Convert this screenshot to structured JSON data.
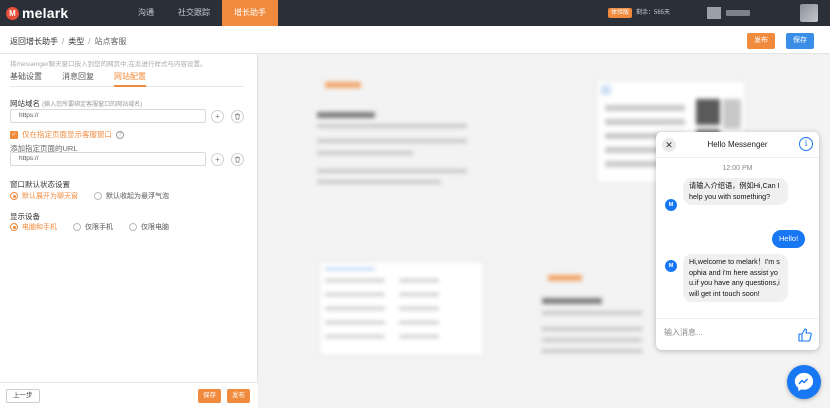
{
  "brand": {
    "name": "melark",
    "mark": "M"
  },
  "nav": [
    {
      "label": "沟通",
      "active": false
    },
    {
      "label": "社交跟踪",
      "active": false
    },
    {
      "label": "增长助手",
      "active": true
    }
  ],
  "account": {
    "trial_badge": "体验版",
    "remaining": "剩余：565天"
  },
  "breadcrumb": {
    "back": "返回增长助手",
    "level1": "类型",
    "current": "站点客服"
  },
  "header_actions": {
    "publish": "发布",
    "save": "保存"
  },
  "panel": {
    "hint": "将messenger聊天窗口嵌入到您的网页中,在此进行样式与内容设置。",
    "tabs": [
      {
        "label": "基础设置",
        "active": false
      },
      {
        "label": "消息回复",
        "active": false
      },
      {
        "label": "网站配置",
        "active": true
      }
    ],
    "domain": {
      "label": "网站域名",
      "sublabel": "(输入您所要绑定客服窗口的网站域名)",
      "value": "https://"
    },
    "specific_pages": {
      "checkbox_label": "仅在指定页面显示客服窗口",
      "checked": true,
      "url_label": "添加指定页面的URL",
      "value": "https://"
    },
    "default_state": {
      "label": "窗口默认状态设置",
      "options": [
        {
          "label": "默认展开为聊天窗",
          "selected": true
        },
        {
          "label": "默认收起为悬浮气泡",
          "selected": false
        }
      ]
    },
    "device": {
      "label": "显示设备",
      "options": [
        {
          "label": "电脑和手机",
          "selected": true
        },
        {
          "label": "仅限手机",
          "selected": false
        },
        {
          "label": "仅限电脑",
          "selected": false
        }
      ]
    },
    "footer": {
      "prev": "上一步",
      "save": "保存",
      "publish": "发布"
    }
  },
  "messenger": {
    "title": "Hello Messenger",
    "time": "12:00 PM",
    "avatar_letter": "M",
    "messages": [
      {
        "from": "page",
        "text": "请输入介绍语，例如Hi,Can I help you with something?"
      },
      {
        "from": "user",
        "text": "Hello!"
      },
      {
        "from": "page",
        "text": "Hi,welcome to melark！I'm sophia and i'm here assist you.if you have any questions,i will get int touch soon!"
      }
    ],
    "input_placeholder": "输入消息..."
  },
  "colors": {
    "accent": "#f08a3c",
    "messenger_blue": "#1877f2",
    "topbar": "#2b2f38"
  }
}
